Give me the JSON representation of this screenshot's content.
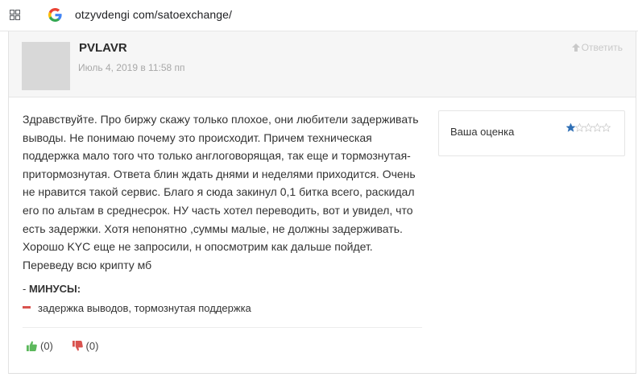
{
  "browser": {
    "url": "otzyvdengi com/satoexchange/"
  },
  "comment": {
    "author": "PVLAVR",
    "date": "Июль 4, 2019 в 11:58 пп",
    "reply_label": "Ответить",
    "body_lines": [
      "Здравствуйте. Про биржу скажу только плохое, они любители задерживать",
      "выводы. Не понимаю почему это происходит. Причем техническая",
      "поддержка мало того что только англоговорящая, так еще и тормознутая-",
      "притормознутая. Ответа блин ждать днями и неделями приходится. Очень",
      "не нравится такой сервис. Благо я сюда закинул 0,1 битка всего, раскидал",
      "его по альтам в среднесрок. НУ часть хотел переводить, вот и увидел, что",
      "есть задержки. Хотя непонятно ,суммы малые, не должны задерживать.",
      "Хорошо KYC еще не запросили, н опосмотрим как дальше пойдет.",
      "Переведу всю крипту мб"
    ],
    "cons_prefix": "- ",
    "cons_title": "МИНУСЫ:",
    "cons_items": [
      "задержка выводов, тормознутая поддержка"
    ],
    "likes": "(0)",
    "dislikes": "(0)",
    "rating": {
      "label": "Ваша оценка",
      "value": 1,
      "max": 5
    }
  },
  "colors": {
    "star_filled": "#2f6fb5",
    "star_empty": "#c8c8c8",
    "like": "#5cb85c",
    "dislike": "#d9534f",
    "minus_mark": "#d9534f"
  },
  "icons": [
    "apps-grid-icon",
    "google-g-icon",
    "reply-arrow-icon",
    "thumbs-up-icon",
    "thumbs-down-icon",
    "star-icon"
  ]
}
